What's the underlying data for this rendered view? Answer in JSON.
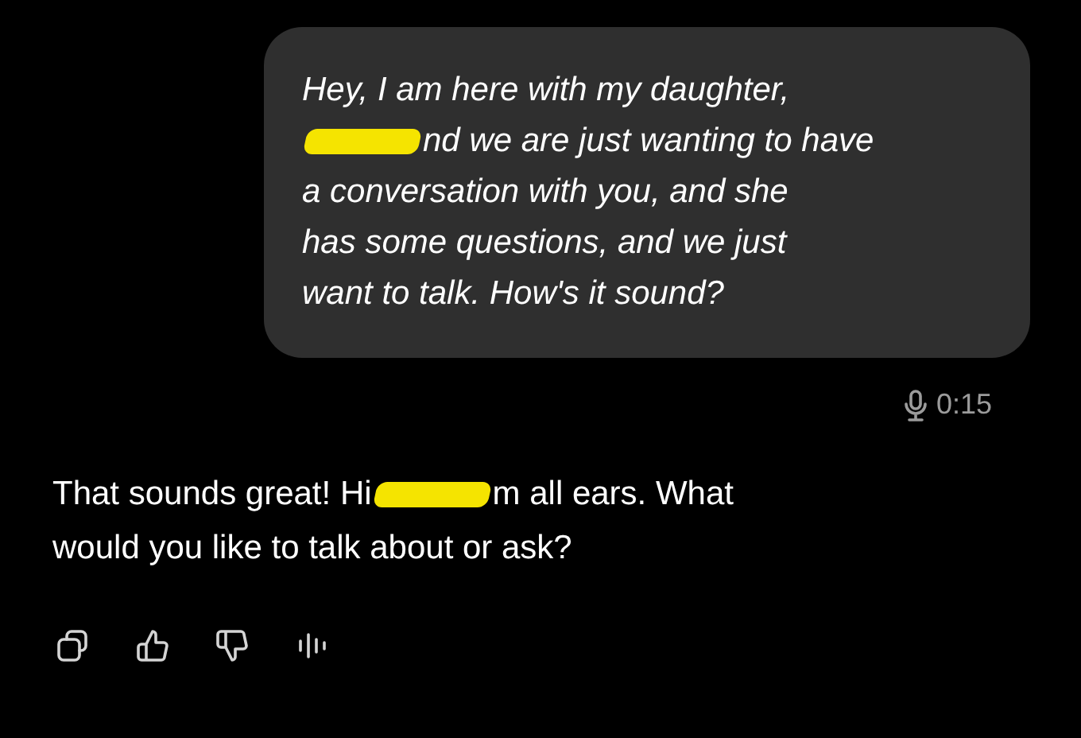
{
  "user_message": {
    "lines": [
      [
        {
          "kind": "text",
          "text": "Hey, I am here with my daughter,"
        }
      ],
      [
        {
          "kind": "redaction"
        },
        {
          "kind": "text",
          "text": "nd we are just wanting to have"
        }
      ],
      [
        {
          "kind": "text",
          "text": "a conversation with you, and she"
        }
      ],
      [
        {
          "kind": "text",
          "text": "has some questions, and we just"
        }
      ],
      [
        {
          "kind": "text",
          "text": "want to talk. How's it sound?"
        }
      ]
    ],
    "voice_duration": "0:15"
  },
  "assistant_message": {
    "lines": [
      [
        {
          "kind": "text",
          "text": "That sounds great! Hi"
        },
        {
          "kind": "redaction"
        },
        {
          "kind": "text",
          "text": "m all ears. What"
        }
      ],
      [
        {
          "kind": "text",
          "text": "would you like to talk about or ask?"
        }
      ]
    ]
  },
  "actions": [
    {
      "kind": "copy"
    },
    {
      "kind": "like"
    },
    {
      "kind": "dislike"
    },
    {
      "kind": "voice"
    }
  ]
}
